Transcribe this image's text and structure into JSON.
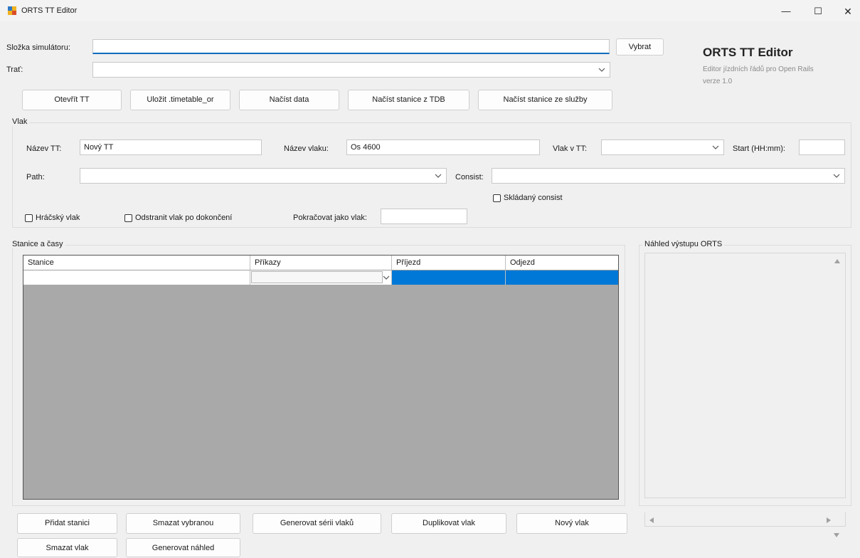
{
  "window": {
    "title": "ORTS TT Editor",
    "minimize_glyph": "—",
    "maximize_glyph": "☐",
    "close_glyph": "✕"
  },
  "top": {
    "sim_folder_label": "Složka simulátoru:",
    "sim_folder_value": "",
    "route_label": "Trať:",
    "route_value": "",
    "select_button": "Vybrat"
  },
  "branding": {
    "title": "ORTS TT Editor",
    "subtitle": "Editor jízdních řádů pro Open Rails",
    "version": "verze 1.0"
  },
  "toolbar": {
    "open_tt": "Otevřít TT",
    "save_tt": "Uložit .timetable_or",
    "load_data": "Načíst data",
    "load_stations_tdb": "Načíst stanice z TDB",
    "load_stations_service": "Načíst stanice ze služby"
  },
  "train": {
    "group_title": "Vlak",
    "tt_name_label": "Název TT:",
    "tt_name_value": "Nový TT",
    "train_name_label": "Název vlaku:",
    "train_name_value": "Os 4600",
    "train_in_tt_label": "Vlak v TT:",
    "train_in_tt_value": "",
    "start_label": "Start (HH:mm):",
    "start_value": "",
    "path_label": "Path:",
    "path_value": "",
    "consist_label": "Consist:",
    "consist_value": "",
    "composite_consist_label": "Skládaný consist",
    "player_train_label": "Hráčský vlak",
    "remove_train_label": "Odstranit vlak po dokončení",
    "continue_as_label": "Pokračovat jako vlak:",
    "continue_as_value": ""
  },
  "stations": {
    "group_title": "Stanice a časy",
    "columns": [
      "Stanice",
      "Příkazy",
      "Příjezd",
      "Odjezd"
    ],
    "selection_color": "#0078d7",
    "grid_bg_color": "#a9a9a9"
  },
  "preview": {
    "group_title": "Náhled výstupu ORTS",
    "content": ""
  },
  "actions": {
    "add_station": "Přidat stanici",
    "delete_selected": "Smazat vybranou",
    "generate_series": "Generovat sérii vlaků",
    "duplicate_train": "Duplikovat vlak",
    "new_train": "Nový vlak",
    "delete_train": "Smazat vlak",
    "generate_preview": "Generovat náhled"
  },
  "icons": {
    "app": "app-window-icon",
    "dropdown": "chevron-down-icon",
    "scroll_up": "scroll-up-arrow-icon",
    "scroll_down": "scroll-down-arrow-icon",
    "scroll_left": "scroll-left-arrow-icon",
    "scroll_right": "scroll-right-arrow-icon"
  }
}
